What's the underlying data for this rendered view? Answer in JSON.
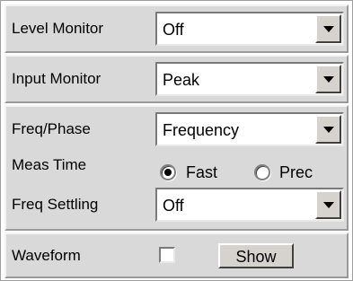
{
  "level_monitor": {
    "label": "Level Monitor",
    "value": "Off"
  },
  "input_monitor": {
    "label": "Input Monitor",
    "value": "Peak"
  },
  "freq_phase": {
    "label": "Freq/Phase",
    "value": "Frequency"
  },
  "meas_time": {
    "label": "Meas Time",
    "options": [
      "Fast",
      "Prec"
    ],
    "selected": "Fast"
  },
  "freq_settling": {
    "label": "Freq Settling",
    "value": "Off"
  },
  "waveform": {
    "label": "Waveform",
    "checked": false,
    "button_label": "Show"
  },
  "colors": {
    "panel_bg": "#d9d9d9",
    "field_bg": "#ffffff"
  },
  "icons": {
    "dropdown": "chevron-down-icon"
  }
}
